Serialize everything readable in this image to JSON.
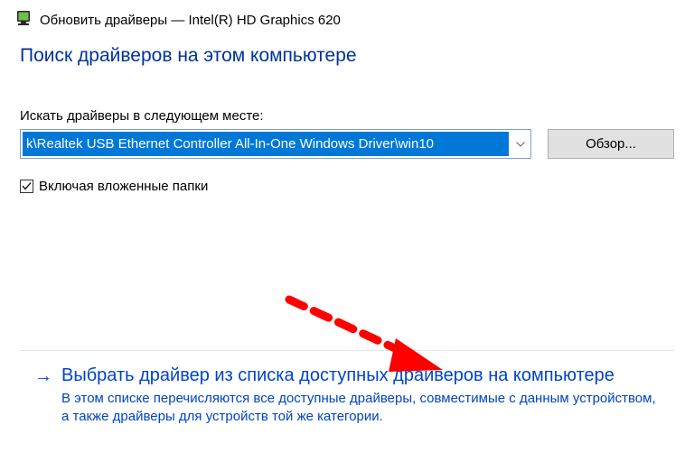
{
  "window": {
    "title": "Обновить драйверы — Intel(R) HD Graphics 620"
  },
  "heading": "Поиск драйверов на этом компьютере",
  "path_field": {
    "label": "Искать драйверы в следующем месте:",
    "value": "k\\Realtek USB Ethernet Controller All-In-One Windows Driver\\win10",
    "browse_label": "Обзор..."
  },
  "include_subfolders": {
    "label": "Включая вложенные папки",
    "checked": true
  },
  "pick_from_list": {
    "title": "Выбрать драйвер из списка доступных драйверов на компьютере",
    "description": "В этом списке перечисляются все доступные драйверы, совместимые с данным устройством, а также драйверы для устройств той же категории."
  }
}
